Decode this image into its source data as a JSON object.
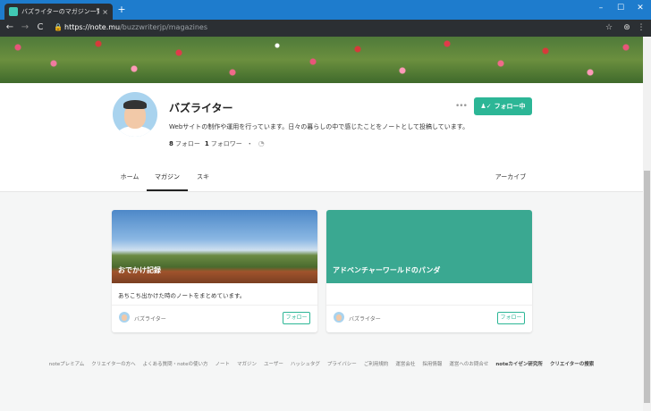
{
  "browser": {
    "tab_title": "バズライターのマガジン一覧｜note",
    "tab_close": "×",
    "new_tab": "+",
    "window_buttons": [
      "–",
      "☐",
      "✕"
    ],
    "url_host": "https://note.mu",
    "url_path": "/buzzwriterjp/magazines",
    "nav": {
      "back": "←",
      "forward": "→",
      "reload": "C"
    }
  },
  "profile": {
    "name": "バズライター",
    "description": "Webサイトの制作や運用を行っています。日々の暮らしの中で感じたことをノートとして投稿しています。",
    "follow_button": "フォロー中",
    "more": "•••",
    "following_count": "8",
    "following_label": "フォロー",
    "follower_count": "1",
    "follower_label": "フォロワー",
    "dot": "・"
  },
  "tabs": [
    {
      "label": "ホーム"
    },
    {
      "label": "マガジン"
    },
    {
      "label": "スキ"
    },
    {
      "label": "アーカイブ"
    }
  ],
  "cards": [
    {
      "title": "おでかけ記録",
      "description": "あちこち出かけた時のノートをまとめています。",
      "author": "バズライター",
      "follow": "フォロー"
    },
    {
      "title": "アドベンチャーワールドのパンダ",
      "description": "",
      "author": "バズライター",
      "follow": "フォロー"
    }
  ],
  "footer": [
    "noteプレミアム",
    "クリエイターの方へ",
    "よくある質問・noteの使い方",
    "ノート",
    "マガジン",
    "ユーザー",
    "ハッシュタグ",
    "プライバシー",
    "ご利用規約",
    "運営会社",
    "採用情報",
    "運営へのお問合せ",
    "noteカイゼン研究所",
    "クリエイターの捜索"
  ],
  "colors": {
    "accent": "#2cb696",
    "tabbar": "#1e7ccd",
    "toolbar": "#2b2f33"
  },
  "icons": [
    "note-favicon-icon",
    "lock-icon",
    "star-icon",
    "extension-icon",
    "menu-icon",
    "more-icon",
    "user-check-icon",
    "rss-icon"
  ]
}
